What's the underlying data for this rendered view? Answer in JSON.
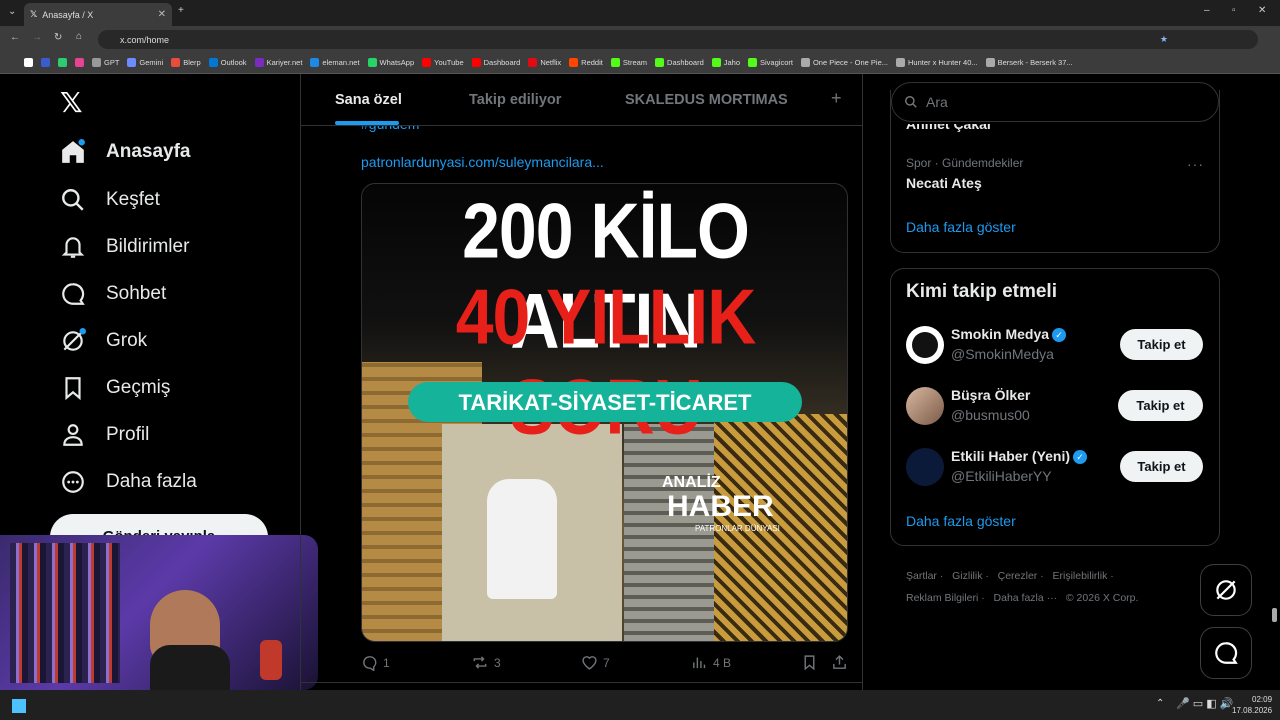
{
  "browser": {
    "tab_title": "Anasayfa / X",
    "url": "x.com/home",
    "bookmarks": [
      "GPT",
      "Gemini",
      "Blerp",
      "Outlook",
      "Kariyer.net",
      "eleman.net",
      "WhatsApp",
      "YouTube",
      "Dashboard",
      "Netflix",
      "Reddit",
      "Stream",
      "Dashboard",
      "Jaho",
      "Sivagicort",
      "One Piece - One Pie...",
      "Hunter x Hunter 40...",
      "Berserk - Berserk 37..."
    ]
  },
  "nav": {
    "items": [
      "Anasayfa",
      "Keşfet",
      "Bildirimler",
      "Sohbet",
      "Grok",
      "Geçmiş",
      "Profil",
      "Daha fazla"
    ],
    "post_button": "Gönderi yayınla"
  },
  "feed": {
    "tabs": [
      "Sana özel",
      "Takip ediliyor",
      "SKALEDUS MORTIMAS"
    ],
    "add_tab": "+",
    "hashtag": "#gündem",
    "link": "patronlardunyasi.com/suleymancilara...",
    "image": {
      "line1": "200 KİLO ALTIN",
      "line2": "40 YILLIK SORU",
      "banner": "TARİKAT-SİYASET-TİCARET",
      "logo_top": "ANALİZ",
      "logo_main": "HABER",
      "logo_sub": "PATRONLAR DÜNYASI"
    },
    "actions": {
      "replies": "1",
      "reposts": "3",
      "likes": "7",
      "views": "4 B"
    }
  },
  "sidebar": {
    "search_placeholder": "Ara",
    "trends": {
      "cut_name": "Ahmet Çakar",
      "category": "Spor · Gündemdekiler",
      "name": "Necati Ateş",
      "more": "Daha fazla göster"
    },
    "who_to_follow": {
      "title": "Kimi takip etmeli",
      "users": [
        {
          "name": "Smokin Medya",
          "handle": "@SmokinMedya",
          "button": "Takip et"
        },
        {
          "name": "Büşra Ölker",
          "handle": "@busmus00",
          "button": "Takip et"
        },
        {
          "name": "Etkili Haber (Yeni)",
          "handle": "@EtkiliHaberYY",
          "button": "Takip et"
        }
      ],
      "more": "Daha fazla göster"
    },
    "footer": [
      "Şartlar",
      "Gizlilik",
      "Çerezler",
      "Erişilebilirlik",
      "Reklam Bilgileri",
      "Daha fazla ···",
      "© 2026 X Corp."
    ]
  },
  "taskbar": {
    "time": "02:09",
    "date": "17.08.2026"
  },
  "colors": {
    "accent": "#1d9bf0",
    "text": "#e7e9ea",
    "muted": "#71767b",
    "border": "#2f3336"
  }
}
